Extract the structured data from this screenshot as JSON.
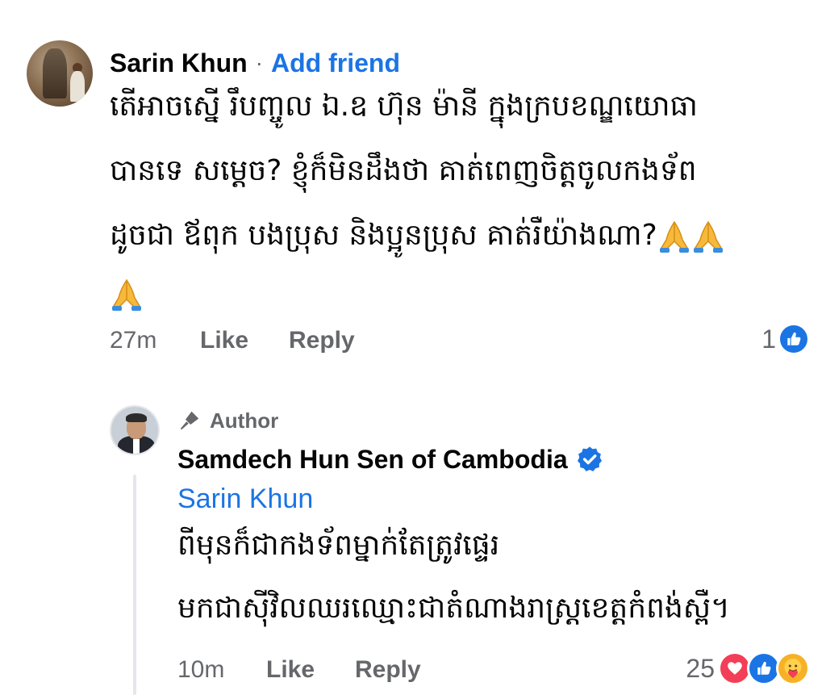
{
  "comment": {
    "author": "Sarin Khun",
    "separator": "·",
    "add_friend": "Add friend",
    "lines": [
      "តើអាចស្នើ រឹបញ្ចូល ឯ.ឧ ហ៊ុន ម៉ានី ក្នុងក្របខណ្ឌយោធា",
      "បានទេ សម្តេច? ខ្ញុំក៏មិនដឹងថា គាត់ពេញចិត្តចូលកងទ័ព",
      "ដូចជា ឪពុក បងប្រុស និងប្អូនប្រុស គាត់រឺយ៉ាងណា?"
    ],
    "emoji_icon": "folded-hands",
    "time": "27m",
    "like": "Like",
    "reply": "Reply",
    "reaction_count": "1"
  },
  "reply": {
    "author_label": "Author",
    "page_name": "Samdech Hun Sen of Cambodia",
    "mention": "Sarin Khun",
    "lines": [
      "ពីមុនក៏ជាកងទ័ពម្នាក់តែត្រូវផ្ទេរ",
      "មកជាស៊ីវិលឈរឈ្មោះជាតំណាងរាស្ត្រខេត្តកំពង់ស្ពឺ។"
    ],
    "time": "10m",
    "like": "Like",
    "reply": "Reply",
    "reaction_count": "25",
    "reaction_icons": [
      "love-icon",
      "like-icon",
      "care-icon"
    ]
  },
  "colors": {
    "link_blue": "#1b74e4",
    "secondary_text": "#65676b",
    "primary_text": "#050505",
    "love_red": "#f33e58",
    "care_yellow": "#f7b125"
  }
}
